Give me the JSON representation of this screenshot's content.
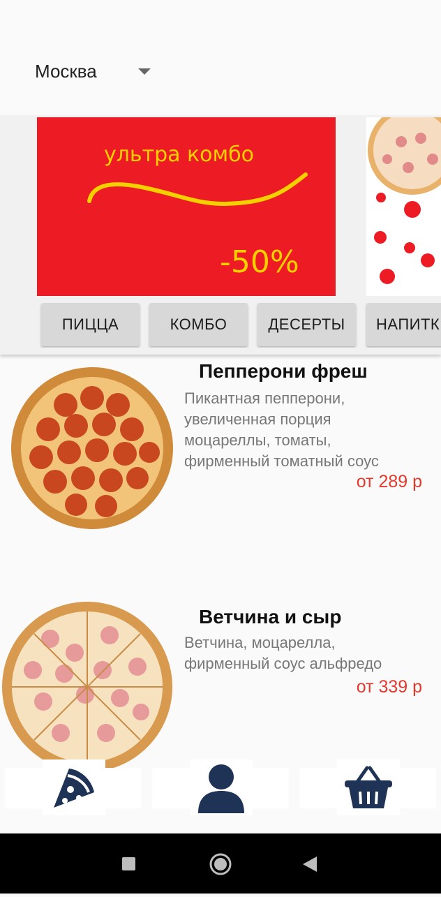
{
  "header": {
    "city": "Москва",
    "dropdown_icon": "arrow-drop-down-icon"
  },
  "banners": [
    {
      "title": "ультра комбо",
      "discount": "-50%",
      "background": "#ed1c24",
      "text_color": "#f5d000"
    },
    {
      "background": "#ffffff"
    }
  ],
  "categories": [
    {
      "label": "ПИЦЦА"
    },
    {
      "label": "КОМБО"
    },
    {
      "label": "ДЕСЕРТЫ"
    },
    {
      "label": "НАПИТКИ"
    }
  ],
  "products": [
    {
      "title": "Пепперони фреш",
      "description": "Пикантная пепперони,\n увеличенная порция\n моцареллы, томаты,\n фирменный томатный соус",
      "price": "от 289 р"
    },
    {
      "title": "Ветчина и сыр",
      "description": "Ветчина, моцарелла,\n фирменный соус альфредо",
      "price": "от 339 р"
    }
  ],
  "bottom_nav": [
    {
      "icon": "pizza-slice-icon"
    },
    {
      "icon": "user-icon"
    },
    {
      "icon": "basket-icon"
    }
  ],
  "system_nav": [
    {
      "icon": "recents-square-icon"
    },
    {
      "icon": "home-circle-icon"
    },
    {
      "icon": "back-triangle-icon"
    }
  ],
  "colors": {
    "accent_price": "#e23a2e",
    "nav_icon": "#1e3356",
    "category_button": "#d8d8d8"
  }
}
